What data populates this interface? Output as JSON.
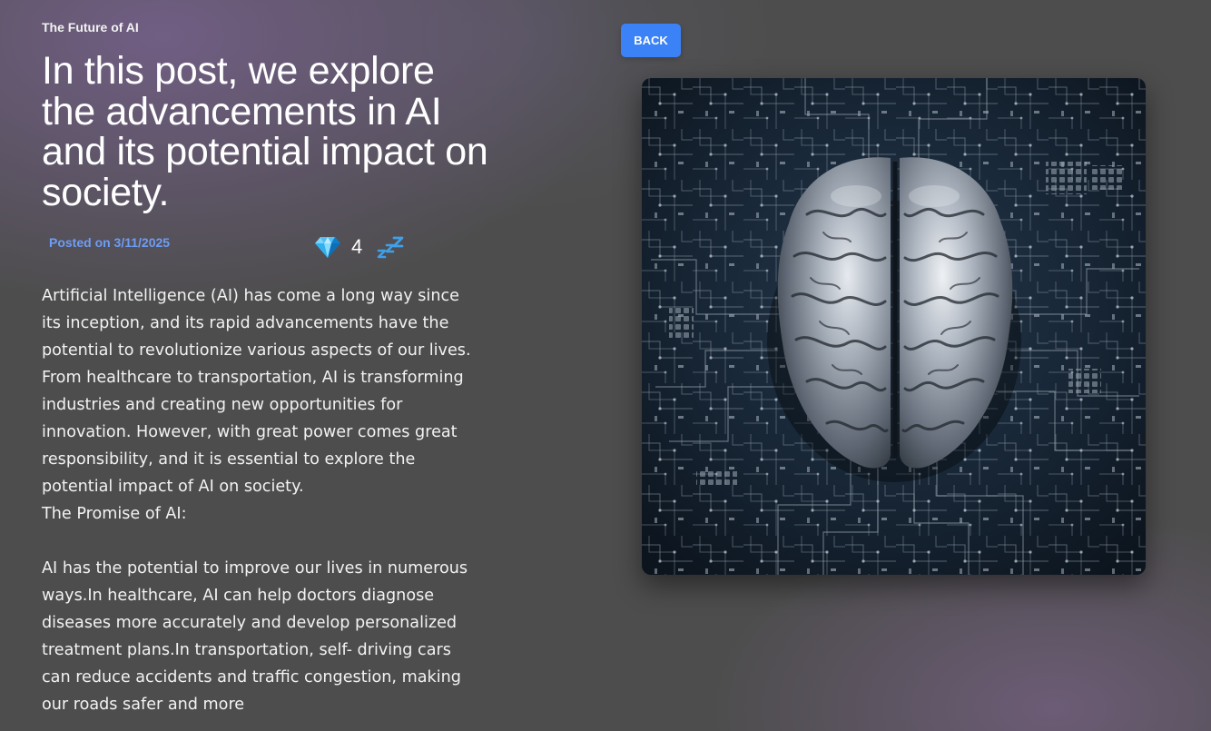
{
  "post": {
    "category": "The Future of AI",
    "title": "In this post, we explore the advancements in AI and its potential impact on society.",
    "posted": "Posted on 3/11/2025",
    "reactions": {
      "count": "4",
      "gem_icon": "gem-icon",
      "sleep_icon": "zzz-icon"
    },
    "body": {
      "p1": "Artificial Intelligence (AI) has come a long way since its inception, and its rapid advancements have the potential to revolutionize various aspects of our lives. From healthcare to transportation, AI is transforming industries and creating new opportunities for innovation. However, with great power comes great responsibility, and it is essential to explore the potential impact of AI on society.",
      "p2": "The Promise of AI:",
      "p3": "AI has the potential to improve our lives in numerous ways.In healthcare, AI can help doctors diagnose diseases more accurately and develop personalized treatment plans.In transportation, self- driving cars can reduce accidents and traffic congestion, making our roads safer and more"
    }
  },
  "nav": {
    "back_label": "BACK"
  },
  "image": {
    "subject": "metallic-brain-on-circuit-board"
  },
  "colors": {
    "accent": "#3b82f6",
    "date": "#6d9df5",
    "background": "#4d4d4d"
  }
}
